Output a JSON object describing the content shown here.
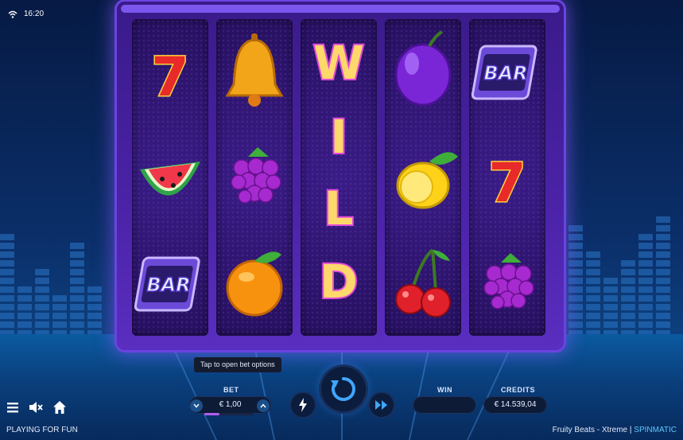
{
  "status": {
    "time": "16:20"
  },
  "game": {
    "title": "Fruity Beats - Xtreme",
    "separator": "|",
    "provider": "SPINMATIC",
    "mode": "PLAYING FOR FUN"
  },
  "reels": [
    [
      "seven",
      "watermelon",
      "bar"
    ],
    [
      "bell",
      "grapes",
      "orange"
    ],
    [
      "wild",
      "wild",
      "wild"
    ],
    [
      "plum",
      "lemon",
      "cherries"
    ],
    [
      "bar",
      "seven",
      "grapes"
    ]
  ],
  "symbol_text": {
    "bar": "BAR",
    "seven": "7",
    "wild": [
      "W",
      "I",
      "L",
      "D"
    ]
  },
  "controls": {
    "tooltip": "Tap to open bet options",
    "bet_label": "BET",
    "bet_value": "€ 1,00",
    "bet_level": 0.3,
    "win_label": "WIN",
    "win_value": "",
    "credits_label": "CREDITS",
    "credits_value": "€ 14.539,04"
  },
  "icons": {
    "menu": "hamburger-icon",
    "sound": "speaker-muted-icon",
    "home": "home-icon",
    "turbo": "lightning-icon",
    "spin": "spin-arrow-icon",
    "autoplay": "fast-forward-icon"
  },
  "colors": {
    "accent": "#5fc8ff",
    "machine": "#4b23a8"
  }
}
